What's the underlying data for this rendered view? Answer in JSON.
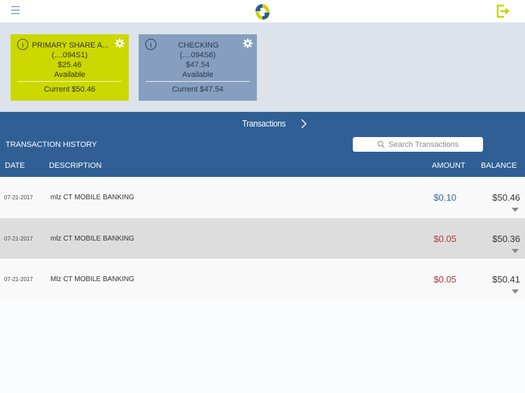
{
  "topbar": {
    "menu_icon": "hamburger-menu-icon",
    "logo_icon": "credit-union-logo",
    "logout_icon": "logout-icon"
  },
  "accounts": [
    {
      "name": "PRIMARY SHARE A...",
      "number": "(....094S1)",
      "available": "$25.46",
      "available_label": "Available",
      "current": "Current $50.46",
      "color": "#ccd800"
    },
    {
      "name": "CHECKING",
      "number": "(....094S6)",
      "available": "$47.54",
      "available_label": "Available",
      "current": "Current $47.54",
      "color": "#869fbf"
    }
  ],
  "transactions": {
    "title": "Transactions",
    "history_label": "TRANSACTION HISTORY",
    "search_placeholder": "Search Transactions",
    "columns": {
      "date": "DATE",
      "description": "DESCRIPTION",
      "amount": "AMOUNT",
      "balance": "BALANCE"
    },
    "rows": [
      {
        "date": "07-21-2017",
        "description": "mlz CT MOBILE BANKING",
        "amount": "$0.10",
        "type": "credit",
        "balance": "$50.46"
      },
      {
        "date": "07-21-2017",
        "description": "mlz CT MOBILE BANKING",
        "amount": "$0.05",
        "type": "debit",
        "balance": "$50.36"
      },
      {
        "date": "07-21-2017",
        "description": "Mlz CT MOBILE BANKING",
        "amount": "$0.05",
        "type": "debit",
        "balance": "$50.41"
      }
    ]
  },
  "colors": {
    "header_blue": "#305f96",
    "accent_green": "#ccd800",
    "credit": "#3a66a3",
    "debit": "#a83a3a"
  }
}
